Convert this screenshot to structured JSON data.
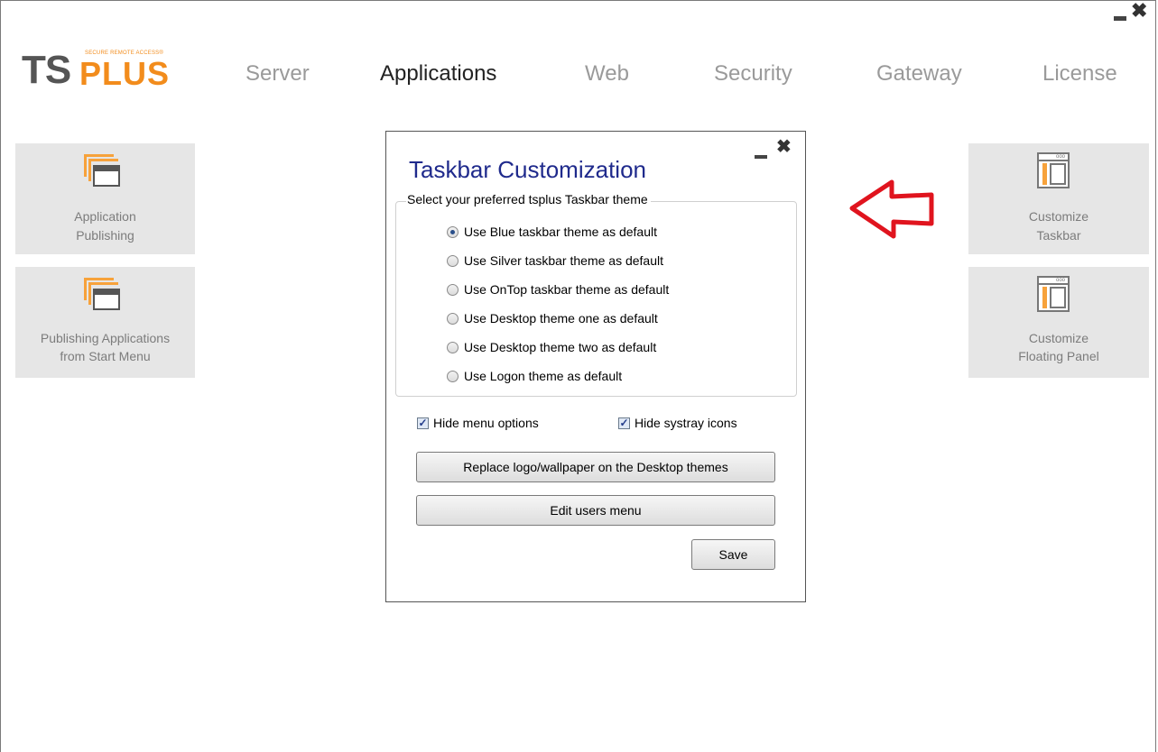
{
  "window": {
    "minimize_icon": "minimize-icon",
    "close_icon": "close-icon",
    "close_glyph": "✖"
  },
  "logo": {
    "brand_main": "TS",
    "brand_plus": "PLUS",
    "tagline": "SECURE REMOTE ACCESS®",
    "accent_color": "#f28c1c"
  },
  "nav": {
    "tabs": [
      {
        "label": "Server"
      },
      {
        "label": "Applications",
        "active": true
      },
      {
        "label": "Web"
      },
      {
        "label": "Security"
      },
      {
        "label": "Gateway"
      },
      {
        "label": "License"
      }
    ]
  },
  "left_tiles": [
    {
      "line1": "Application",
      "line2": "Publishing",
      "icon": "windows-stack-icon"
    },
    {
      "line1": "Publishing Applications",
      "line2": "from Start Menu",
      "icon": "windows-stack-icon"
    }
  ],
  "right_tiles": [
    {
      "line1": "Customize",
      "line2": "Taskbar",
      "icon": "panel-window-icon"
    },
    {
      "line1": "Customize",
      "line2": "Floating Panel",
      "icon": "panel-window-icon"
    }
  ],
  "arrow": {
    "icon": "left-arrow-icon",
    "color": "#e0141e"
  },
  "dialog": {
    "title": "Taskbar Customization",
    "close_glyph": "✖",
    "group_label": "Select your preferred tsplus Taskbar theme",
    "themes": [
      {
        "label": "Use Blue taskbar theme as default",
        "selected": true
      },
      {
        "label": "Use Silver taskbar theme as default",
        "selected": false
      },
      {
        "label": "Use OnTop taskbar theme as default",
        "selected": false
      },
      {
        "label": "Use Desktop theme one as default",
        "selected": false
      },
      {
        "label": "Use Desktop theme two as default",
        "selected": false
      },
      {
        "label": "Use Logon theme as default",
        "selected": false
      }
    ],
    "hide_menu": {
      "label": "Hide menu options",
      "checked": true
    },
    "hide_systray": {
      "label": "Hide systray icons",
      "checked": true
    },
    "check_glyph": "✓",
    "replace_button": "Replace logo/wallpaper on the Desktop themes",
    "edit_button": "Edit users menu",
    "save_button": "Save",
    "title_color": "#1f2a8c"
  }
}
